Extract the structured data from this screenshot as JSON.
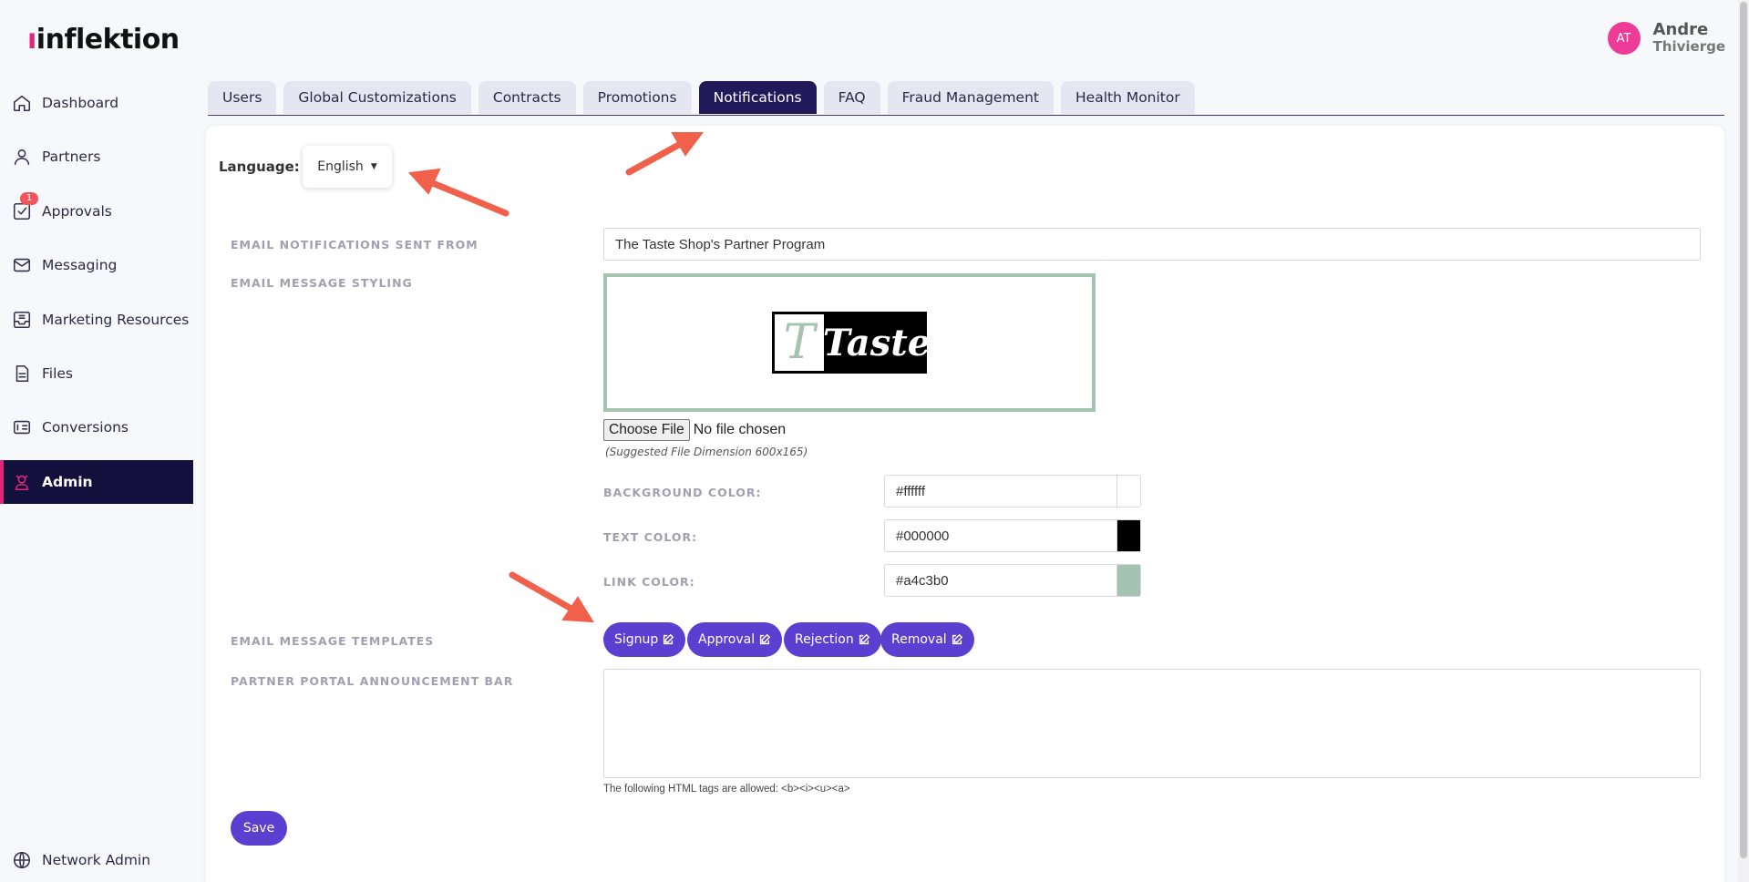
{
  "brand": {
    "name": "inflektion",
    "hook_color": "#e3257a"
  },
  "user": {
    "initials": "AT",
    "first_name": "Andre",
    "last_name": "Thivierge"
  },
  "sidebar": {
    "items": [
      {
        "label": "Dashboard",
        "icon": "home-icon"
      },
      {
        "label": "Partners",
        "icon": "person-icon"
      },
      {
        "label": "Approvals",
        "icon": "checkbox-icon",
        "badge": "1"
      },
      {
        "label": "Messaging",
        "icon": "envelope-icon"
      },
      {
        "label": "Marketing Resources",
        "icon": "tray-icon"
      },
      {
        "label": "Files",
        "icon": "file-icon"
      },
      {
        "label": "Conversions",
        "icon": "dollar-list-icon"
      },
      {
        "label": "Admin",
        "icon": "admin-icon",
        "active": true
      }
    ],
    "footer": {
      "label": "Network Admin",
      "icon": "globe-icon"
    }
  },
  "tabs": [
    {
      "label": "Users"
    },
    {
      "label": "Global Customizations"
    },
    {
      "label": "Contracts"
    },
    {
      "label": "Promotions"
    },
    {
      "label": "Notifications",
      "active": true
    },
    {
      "label": "FAQ"
    },
    {
      "label": "Fraud Management"
    },
    {
      "label": "Health Monitor"
    }
  ],
  "language": {
    "label": "Language:",
    "value": "English"
  },
  "form": {
    "sent_from": {
      "label": "EMAIL NOTIFICATIONS SENT FROM",
      "value": "The Taste Shop's Partner Program"
    },
    "styling": {
      "label": "EMAIL MESSAGE STYLING",
      "logo": {
        "letter": "T",
        "word": "Taste"
      },
      "file": {
        "button": "Choose File",
        "status": "No file chosen",
        "hint": "(Suggested File Dimension 600x165)"
      },
      "background": {
        "label": "BACKGROUND COLOR:",
        "value": "#ffffff"
      },
      "text": {
        "label": "TEXT COLOR:",
        "value": "#000000"
      },
      "link": {
        "label": "LINK COLOR:",
        "value": "#a4c3b0"
      }
    },
    "templates": {
      "label": "EMAIL MESSAGE TEMPLATES",
      "buttons": [
        "Signup",
        "Approval",
        "Rejection",
        "Removal"
      ]
    },
    "announcement": {
      "label": "PARTNER PORTAL ANNOUNCEMENT BAR",
      "value": "",
      "hint": "The following HTML tags are allowed: <b><i><u><a>"
    },
    "save_label": "Save"
  },
  "colors": {
    "accent": "#5b3fd1",
    "active_nav": "#13103e",
    "active_tab": "#22195b",
    "arrow": "#f0604b"
  }
}
